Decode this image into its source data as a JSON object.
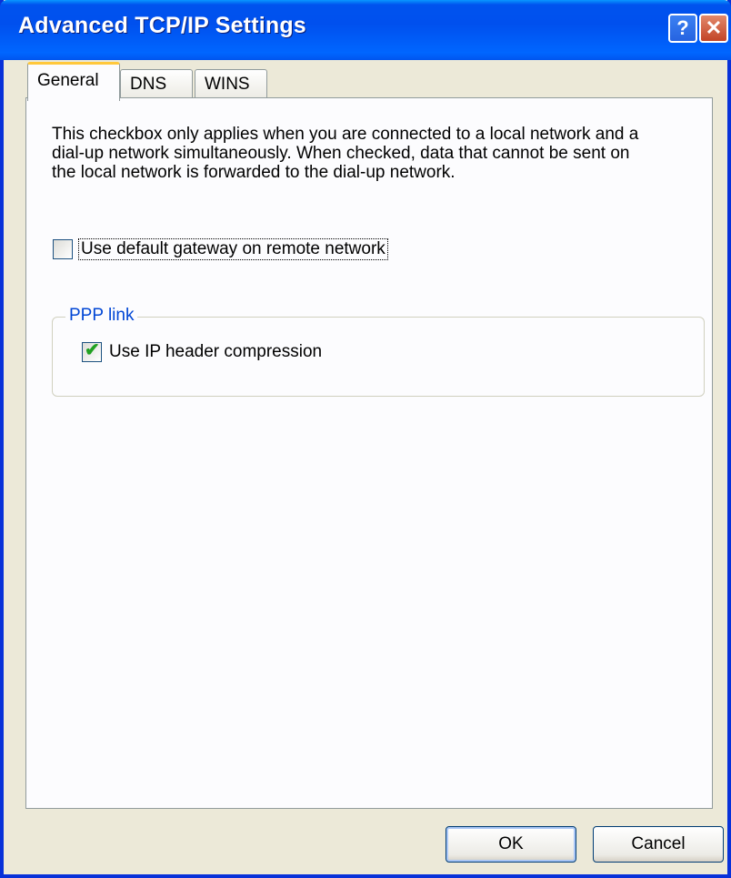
{
  "window": {
    "title": "Advanced TCP/IP Settings",
    "help_label": "?",
    "close_label": "✕"
  },
  "tabs": [
    {
      "label": "General",
      "active": true
    },
    {
      "label": "DNS",
      "active": false
    },
    {
      "label": "WINS",
      "active": false
    }
  ],
  "general": {
    "description": "This checkbox only applies when you are connected to a local network and a dial-up network simultaneously.  When checked, data that cannot be sent on the local network is forwarded to the dial-up network.",
    "default_gateway": {
      "label": "Use default gateway on remote network",
      "checked": false
    },
    "ppp_group": {
      "title": "PPP link",
      "ip_header_compression": {
        "label": "Use IP header compression",
        "checked": true
      }
    }
  },
  "buttons": {
    "ok": "OK",
    "cancel": "Cancel"
  },
  "colors": {
    "title_bar": "#0055ee",
    "group_title": "#0046d5",
    "check_mark": "#21a121",
    "active_tab_accent": "#ffc83c"
  }
}
